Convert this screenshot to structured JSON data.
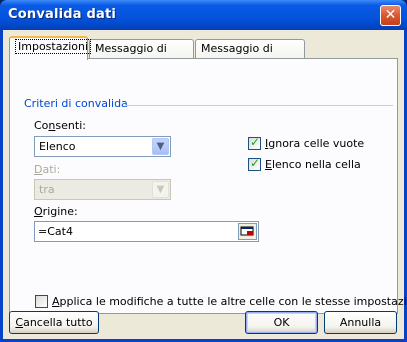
{
  "dialog": {
    "title": "Convalida dati",
    "close_glyph": "✕"
  },
  "tabs": [
    {
      "label": "Impostazioni",
      "active": true
    },
    {
      "label": "Messaggio di input",
      "active": false
    },
    {
      "label": "Messaggio di errore",
      "active": false
    }
  ],
  "group": {
    "title": "Criteri di convalida"
  },
  "allow": {
    "label_first": "Co",
    "label_accel": "n",
    "label_rest": "senti:",
    "value": "Elenco"
  },
  "data": {
    "label_accel": "D",
    "label_rest": "ati:",
    "value": "tra"
  },
  "source": {
    "label_accel": "O",
    "label_rest": "rigine:",
    "value": "=Cat4"
  },
  "checks": {
    "ignore_blank": {
      "accel": "I",
      "rest": "gnora celle vuote",
      "checked": true
    },
    "in_cell_dropdown": {
      "accel": "E",
      "rest": "lenco nella cella",
      "checked": true
    },
    "apply_all": {
      "accel": "A",
      "rest": "pplica le modifiche a tutte le altre celle con le stesse impostazioni",
      "checked": false
    }
  },
  "buttons": {
    "clear_all_accel": "C",
    "clear_all_rest": "ancella tutto",
    "ok": "OK",
    "cancel": "Annulla"
  },
  "colors": {
    "title_bar": "#0553dc",
    "group_title": "#0046d5",
    "check_mark": "#21a121"
  }
}
